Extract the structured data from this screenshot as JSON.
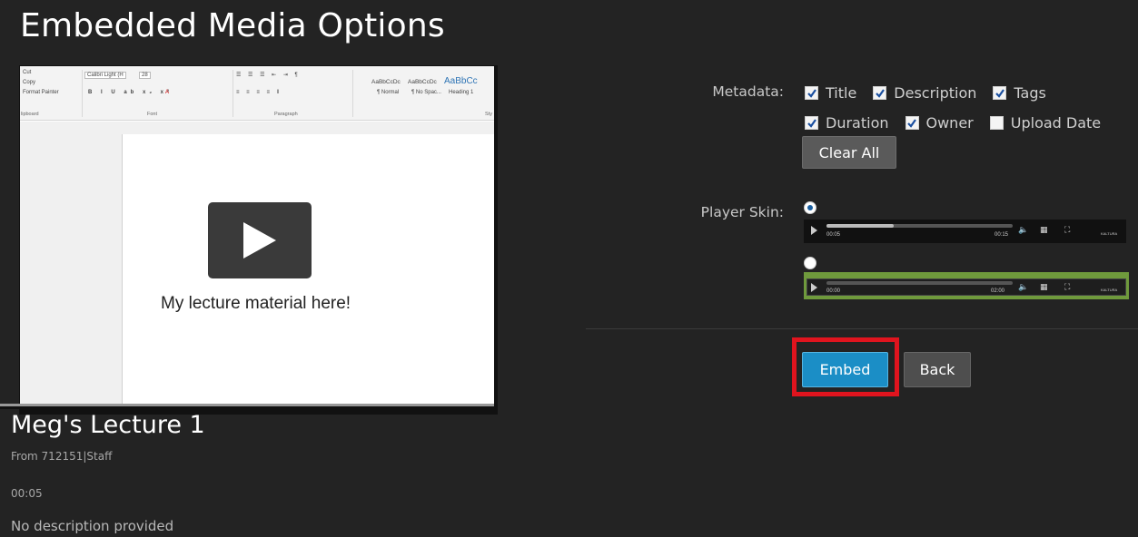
{
  "page": {
    "title": "Embedded Media Options"
  },
  "preview": {
    "ribbon": {
      "cut": "Cut",
      "copy": "Copy",
      "format_painter": "Format Painter",
      "clipboard": "lipboard",
      "font_name": "Calibri Light (H",
      "font_size": "28",
      "font_group": "Font",
      "paragraph_group": "Paragraph",
      "styles_group": "Sty",
      "style1_sample": "AaBbCcDc",
      "style1_name": "¶ Normal",
      "style2_sample": "AaBbCcDc",
      "style2_name": "¶ No Spac...",
      "style3_sample": "AaBbCc",
      "style3_name": "Heading 1"
    },
    "slide_text": "My lecture material here!"
  },
  "media": {
    "title": "Meg's Lecture 1",
    "from": "From 712151|Staff",
    "duration": "00:05",
    "description": "No description provided"
  },
  "options": {
    "metadata_label": "Metadata:",
    "metadata": [
      {
        "label": "Title",
        "checked": true
      },
      {
        "label": "Description",
        "checked": true
      },
      {
        "label": "Tags",
        "checked": true
      },
      {
        "label": "Duration",
        "checked": true
      },
      {
        "label": "Owner",
        "checked": true
      },
      {
        "label": "Upload Date",
        "checked": false
      }
    ],
    "clear_all_label": "Clear All",
    "player_skin_label": "Player Skin:",
    "skins": [
      {
        "selected": true,
        "time_current": "00:05",
        "time_total": "00:15",
        "progress": 0.36,
        "brand": "KALTURA"
      },
      {
        "selected": false,
        "time_current": "00:00",
        "time_total": "02:00",
        "progress": 0.0,
        "brand": "KALTURA"
      }
    ]
  },
  "actions": {
    "embed_label": "Embed",
    "back_label": "Back",
    "highlight_color": "#e0141e",
    "embed_color": "#1b8ec6"
  }
}
